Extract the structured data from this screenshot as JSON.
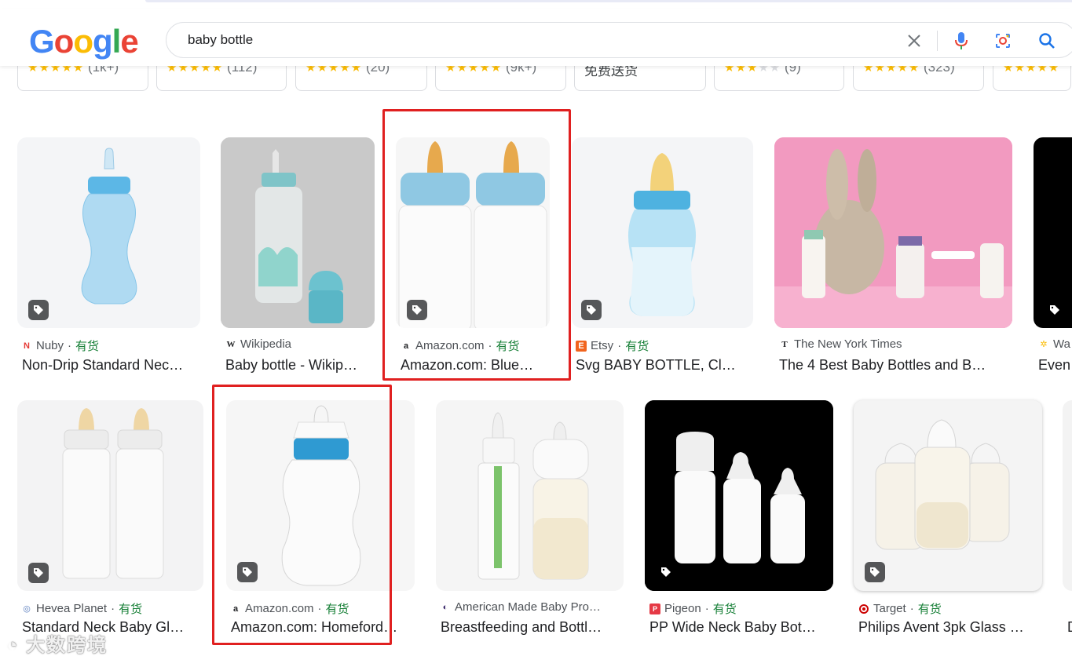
{
  "search": {
    "query": "baby bottle"
  },
  "logo": {
    "text": "Google"
  },
  "chips": [
    {
      "stars": "★★★★",
      "half": "★",
      "count": "(1k+)"
    },
    {
      "stars": "★★★★★",
      "count": "(112)"
    },
    {
      "stars": "★★★★★",
      "count": "(20)"
    },
    {
      "stars": "★★★★★",
      "count": "(9k+)"
    },
    {
      "text": "免费送货"
    },
    {
      "stars": "★★★",
      "off": "★★",
      "count": "(9)"
    },
    {
      "stars": "★★★★★",
      "count": "(323)"
    },
    {
      "stars": "★★★★★",
      "count": ""
    }
  ],
  "row1": [
    {
      "source": "Nuby",
      "available": "有货",
      "title": "Non-Drip Standard Nec…"
    },
    {
      "source": "Wikipedia",
      "available": "",
      "title": "Baby bottle - Wikip…"
    },
    {
      "source": "Amazon.com",
      "available": "有货",
      "title": "Amazon.com: Blue…"
    },
    {
      "source": "Etsy",
      "available": "有货",
      "title": "Svg BABY BOTTLE, Cl…"
    },
    {
      "source": "The New York Times",
      "available": "",
      "title": "The 4 Best Baby Bottles and B…"
    },
    {
      "source": "Wa",
      "available": "",
      "title": "Even"
    }
  ],
  "row2": [
    {
      "source": "Hevea Planet",
      "available": "有货",
      "title": "Standard Neck Baby Gl…"
    },
    {
      "source": "Amazon.com",
      "available": "有货",
      "title": "Amazon.com: Homeford…"
    },
    {
      "source": "American Made Baby Pro…",
      "available": "",
      "title": "Breastfeeding and Bottl…"
    },
    {
      "source": "Pigeon",
      "available": "有货",
      "title": "PP Wide Neck Baby Bot…"
    },
    {
      "source": "Target",
      "available": "有货",
      "title": "Philips Avent 3pk Glass …"
    },
    {
      "source": "",
      "available": "",
      "title": "D"
    }
  ],
  "sep": " · ",
  "watermark": "大数跨境",
  "colors": {
    "accent_red": "#e02020",
    "available_green": "#188038",
    "bottle_blue": "#5bbbe0"
  }
}
